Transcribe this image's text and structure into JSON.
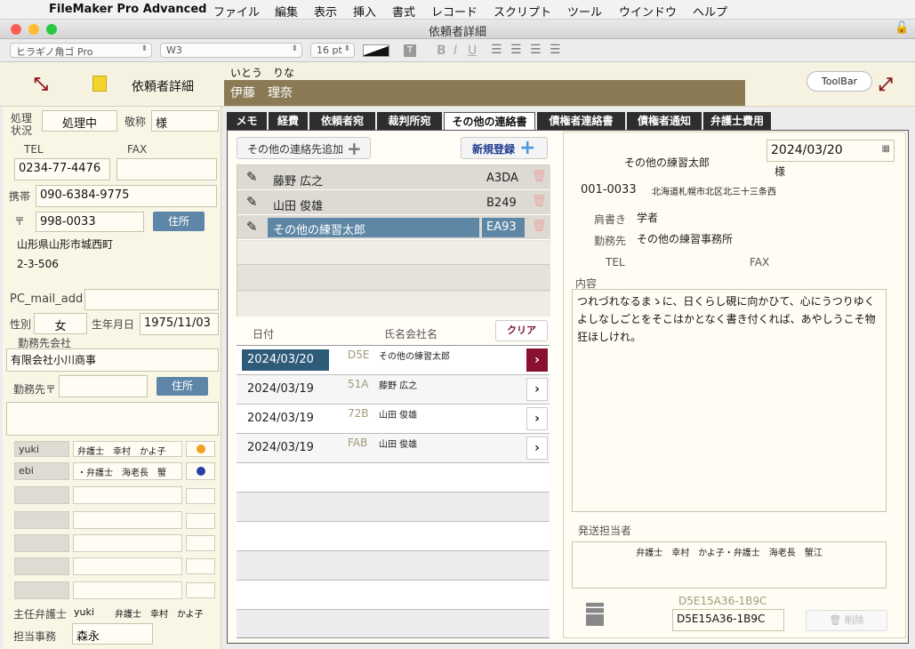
{
  "menubar": {
    "app_name": "FileMaker Pro Advanced",
    "items": [
      "ファイル",
      "編集",
      "表示",
      "挿入",
      "書式",
      "レコード",
      "スクリプト",
      "ツール",
      "ウインドウ",
      "ヘルプ"
    ]
  },
  "window": {
    "title": "依頼者詳細"
  },
  "formatbar": {
    "font": "ヒラギノ角ゴ Pro",
    "weight": "W3",
    "size": "16 pt",
    "bold": "B",
    "italic": "I",
    "underline": "U",
    "text_icon": "T"
  },
  "header": {
    "title": "依頼者詳細",
    "kana": "いとう　りな",
    "name": "伊藤　理奈",
    "toolbar_button": "ToolBar"
  },
  "left": {
    "status_label": "処理\n状況",
    "status_value": "処理中",
    "honorific_label": "敬称",
    "honorific_value": "様",
    "tel_label": "TEL",
    "fax_label": "FAX",
    "tel_value": "0234-77-4476",
    "fax_value": "",
    "mobile_label": "携帯",
    "mobile_value": "090-6384-9775",
    "zip_label": "〒",
    "zip_value": "998-0033",
    "address_button": "住所",
    "address1": "山形県山形市城西町",
    "address2": "2-3-506",
    "pcmail_label": "PC_mail_add",
    "pcmail_value": "",
    "gender_label": "性別",
    "gender_value": "女",
    "birthday_label": "生年月日",
    "birthday_value": "1975/11/03",
    "company_label": "勤務先会社",
    "company_value": "有限会社小川商事",
    "company_zip_label": "勤務先〒",
    "company_zip_value": "",
    "company_address_button": "住所",
    "staff": [
      {
        "user": "yuki",
        "name": "弁護士　幸村　かよ子",
        "color": "#f0a020"
      },
      {
        "user": "ebi",
        "name": "・弁護士　海老長　蟹",
        "color": "#2a3ea8"
      }
    ],
    "lead_lawyer_label": "主任弁護士",
    "lead_lawyer_user": "yuki",
    "lead_lawyer_name": "弁護士　幸村　かよ子",
    "office_label": "担当事務",
    "office_value": "森永"
  },
  "tabs": [
    "メモ",
    "経費",
    "依頼者宛",
    "裁判所宛",
    "その他の連絡書",
    "債権者連絡書",
    "債権者通知",
    "弁護士費用"
  ],
  "contacts": {
    "add_button": "その他の連絡先追加",
    "new_button": "新規登録",
    "rows": [
      {
        "name": "藤野 広之",
        "code": "A3DA"
      },
      {
        "name": "山田 俊雄",
        "code": "B249"
      },
      {
        "name": "その他の練習太郎",
        "code": "EA93"
      }
    ]
  },
  "history": {
    "date_header": "日付",
    "name_header": "氏名会社名",
    "clear_button": "クリア",
    "rows": [
      {
        "date": "2024/03/20",
        "code": "D5E",
        "name": "その他の練習太郎"
      },
      {
        "date": "2024/03/19",
        "code": "51A",
        "name": "藤野 広之"
      },
      {
        "date": "2024/03/19",
        "code": "72B",
        "name": "山田 俊雄"
      },
      {
        "date": "2024/03/19",
        "code": "FAB",
        "name": "山田 俊雄"
      }
    ]
  },
  "detail": {
    "date": "2024/03/20",
    "recipient": "その他の練習太郎",
    "honorific": "様",
    "zip": "001-0033",
    "address": "北海道札幌市北区北三十三条西",
    "title_label": "肩書き",
    "title_value": "学者",
    "workplace_label": "勤務先",
    "workplace_value": "その他の練習事務所",
    "tel_label": "TEL",
    "fax_label": "FAX",
    "content_label": "内容",
    "content": "つれづれなるまゝに、日くらし硯に向かひて、心にうつりゆくよしなしごとをそこはかとなく書き付くれば、あやしうこそ物狂ほしけれ。",
    "sender_label": "発送担当者",
    "sender_value": "弁護士　幸村　かよ子・弁護士　海老長　蟹江",
    "id_display": "D5E15A36-1B9C",
    "id_value": "D5E15A36-1B9C",
    "delete_button": "削除"
  }
}
